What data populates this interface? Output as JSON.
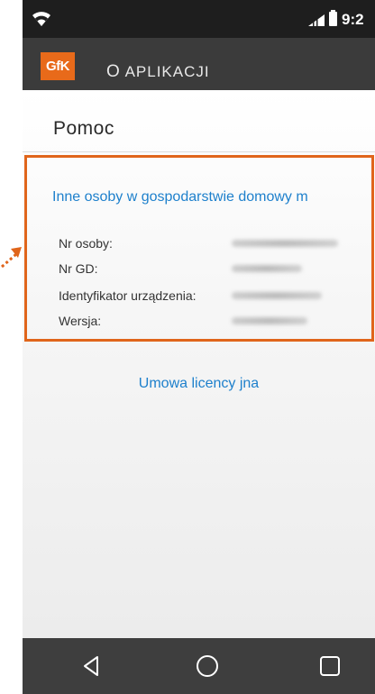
{
  "status_bar": {
    "time": "9:2",
    "wifi_icon": "wifi-icon",
    "signal_icon": "signal-icon",
    "battery_icon": "battery-icon"
  },
  "app_bar": {
    "logo_text": "GfK",
    "title_first": "O",
    "title_rest": " APLIKACJI"
  },
  "help": {
    "title": "Pomoc"
  },
  "household_link": "Inne osoby w gospodarstwie domowy m",
  "info": [
    {
      "label": "Nr osoby:"
    },
    {
      "label": "Nr GD:"
    },
    {
      "label": "Identyfikator  urządzenia:"
    },
    {
      "label": "Wersja:"
    }
  ],
  "license_link": "Umowa licency jna",
  "nav": {
    "back": "back-icon",
    "home": "home-icon",
    "recent": "recent-apps-icon"
  },
  "colors": {
    "accent": "#e0651b",
    "link": "#1e80cc",
    "status_bar": "#1e1e1e",
    "app_bar": "#3b3b3b",
    "nav_bar": "#3e3e3e"
  }
}
